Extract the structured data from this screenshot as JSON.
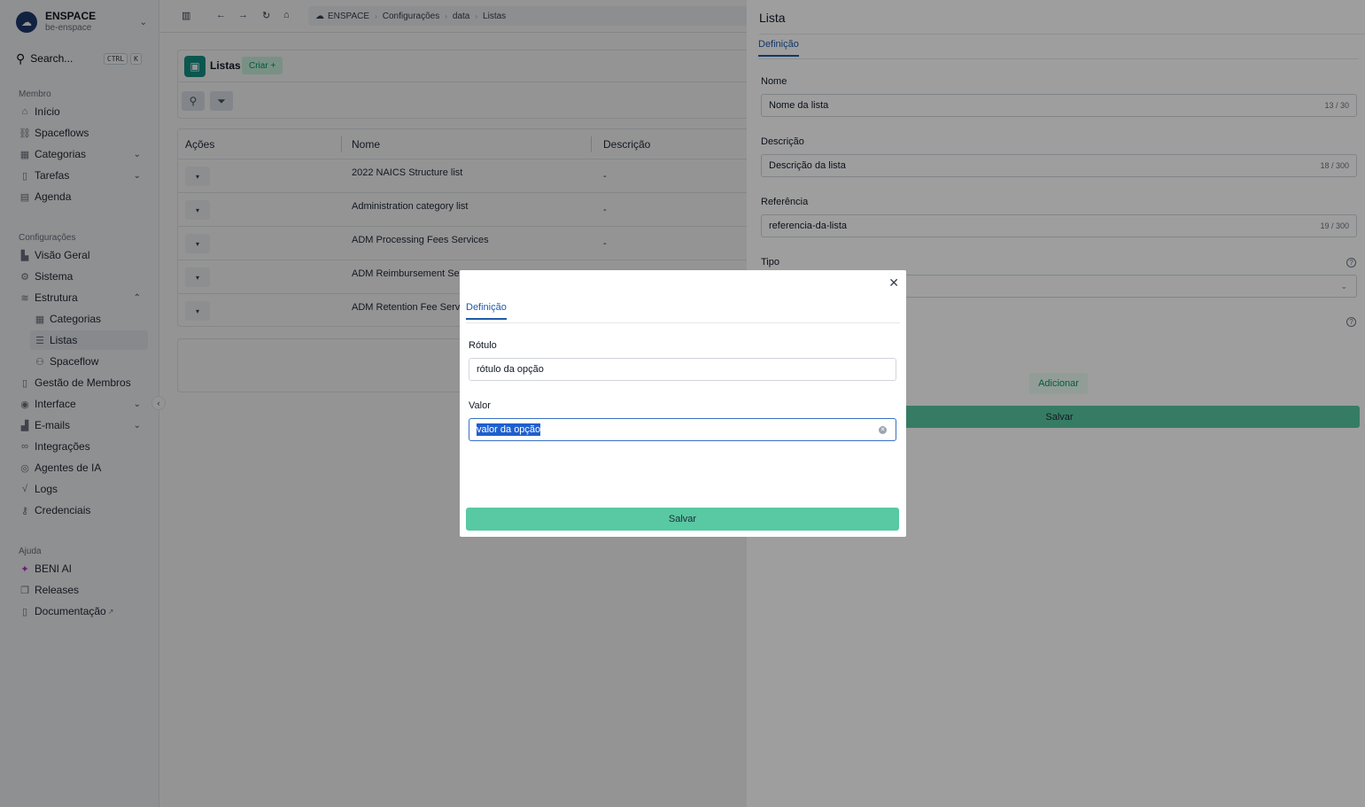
{
  "workspace": {
    "name": "ENSPACE",
    "sub": "be-enspace",
    "logo_icon": "cloud-icon"
  },
  "search": {
    "label": "Search...",
    "kbd1": "CTRL",
    "kbd2": "K"
  },
  "sidebar": {
    "membro_title": "Membro",
    "membro": [
      {
        "label": "Início",
        "icon": "home-icon"
      },
      {
        "label": "Spaceflows",
        "icon": "flow-icon"
      },
      {
        "label": "Categorias",
        "icon": "grid-icon"
      },
      {
        "label": "Tarefas",
        "icon": "file-icon"
      },
      {
        "label": "Agenda",
        "icon": "calendar-icon"
      }
    ],
    "config_title": "Configurações",
    "config": [
      {
        "label": "Visão Geral",
        "icon": "building-icon"
      },
      {
        "label": "Sistema",
        "icon": "gear-icon"
      },
      {
        "label": "Estrutura",
        "icon": "database-icon"
      },
      {
        "label": "Categorias",
        "icon": "grid-icon"
      },
      {
        "label": "Listas",
        "icon": "list-icon"
      },
      {
        "label": "Spaceflow",
        "icon": "tree-icon"
      },
      {
        "label": "Gestão de Membros",
        "icon": "id-icon"
      },
      {
        "label": "Interface",
        "icon": "compass-icon"
      },
      {
        "label": "E-mails",
        "icon": "chart-icon"
      },
      {
        "label": "Integrações",
        "icon": "link-icon"
      },
      {
        "label": "Agentes de IA",
        "icon": "bot-icon"
      },
      {
        "label": "Logs",
        "icon": "activity-icon"
      },
      {
        "label": "Credenciais",
        "icon": "key-icon"
      }
    ],
    "help_title": "Ajuda",
    "help": [
      {
        "label": "BENI AI",
        "icon": "sparkle-icon"
      },
      {
        "label": "Releases",
        "icon": "copy-icon"
      },
      {
        "label": "Documentação",
        "icon": "doc-icon"
      }
    ]
  },
  "breadcrumb": {
    "items": [
      "ENSPACE",
      "Configurações",
      "data",
      "Listas"
    ]
  },
  "list_panel": {
    "title": "Listas",
    "create_label": "Criar +"
  },
  "table": {
    "headers": [
      "Ações",
      "Nome",
      "Descrição"
    ],
    "rows": [
      {
        "name": "2022 NAICS Structure list",
        "desc": "-"
      },
      {
        "name": "Administration category list",
        "desc": "-"
      },
      {
        "name": "ADM Processing Fees Services",
        "desc": "-"
      },
      {
        "name": "ADM Reimbursement Serv",
        "desc": ""
      },
      {
        "name": "ADM Retention Fee Servic",
        "desc": ""
      }
    ]
  },
  "drawer": {
    "title": "Lista",
    "tab": "Definição",
    "nome_label": "Nome",
    "nome_value": "Nome da lista",
    "nome_count": "13 / 30",
    "descricao_label": "Descrição",
    "descricao_value": "Descrição da lista",
    "descricao_count": "18 / 300",
    "referencia_label": "Referência",
    "referencia_value": "referencia-da-lista",
    "referencia_count": "19 / 300",
    "tipo_label": "Tipo",
    "add_label": "Adicionar",
    "save_label": "Salvar"
  },
  "modal": {
    "tab": "Definição",
    "rotulo_label": "Rótulo",
    "rotulo_value": "rótulo da opção",
    "valor_label": "Valor",
    "valor_value": "valor da opção",
    "save_label": "Salvar"
  },
  "colors": {
    "accent": "#1e5aa8",
    "save": "#58c9a2",
    "brand": "#13968a"
  }
}
